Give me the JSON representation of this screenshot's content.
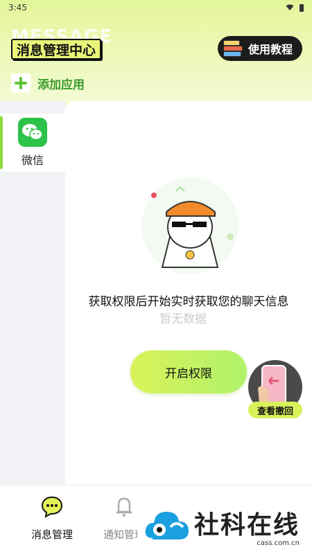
{
  "status_bar": {
    "time": "3:45"
  },
  "header": {
    "watermark": "MESSAGE",
    "title": "消息管理中心",
    "tutorial_label": "使用教程",
    "add_app_label": "添加应用"
  },
  "sidebar": {
    "items": [
      {
        "label": "微信",
        "icon": "wechat-icon",
        "active": true
      }
    ]
  },
  "main": {
    "permission_text": "获取权限后开始实时获取您的聊天信息",
    "faded_text": "暂无数据",
    "enable_button": "开启权限",
    "float_widget_label": "查看撤回"
  },
  "bottom_nav": {
    "items": [
      {
        "label": "消息管理",
        "icon": "chat-bubble-icon",
        "active": true
      },
      {
        "label": "通知管理",
        "icon": "bell-icon",
        "active": false
      }
    ]
  },
  "brand": {
    "name": "社科在线",
    "url": "cass.com.cn"
  },
  "colors": {
    "accent_green": "#8edb3c",
    "button_gradient_start": "#d9f25a",
    "wechat_green": "#2dc24a",
    "header_bg": "#e4f69a"
  }
}
